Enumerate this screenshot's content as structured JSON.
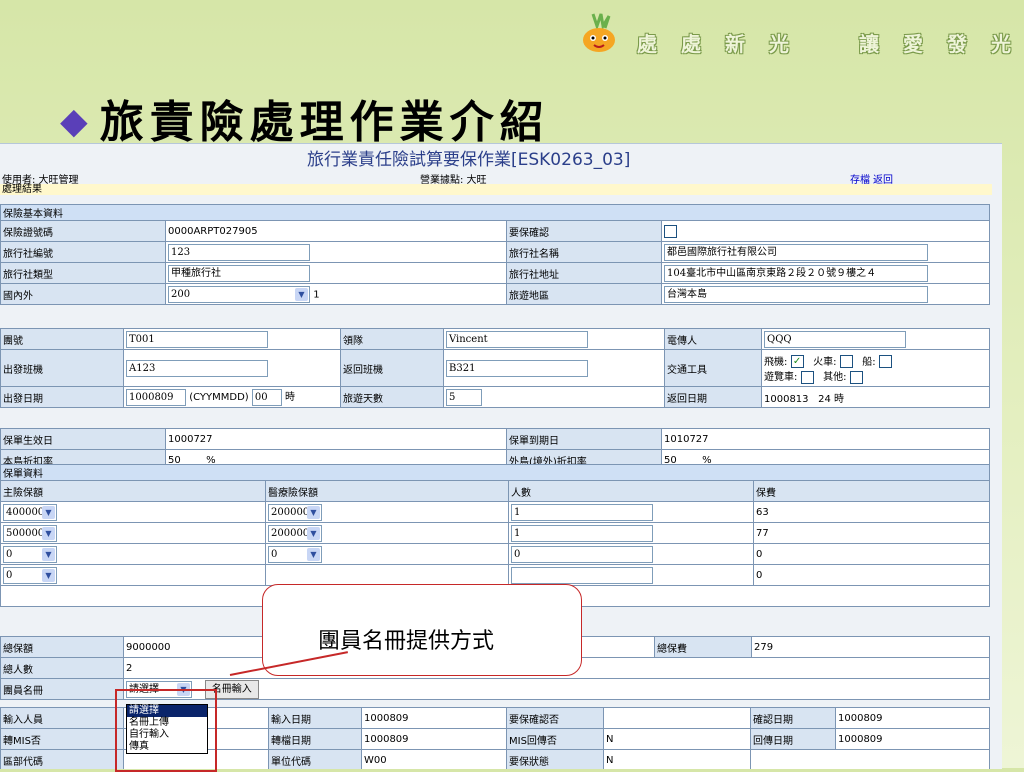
{
  "slogan": [
    "處",
    "處",
    "新",
    "光",
    "讓",
    "愛",
    "發",
    "光"
  ],
  "page_title": "旅責險處理作業介紹",
  "form_title": "旅行業責任險試算要保作業[ESK0263_03]",
  "user": "使用者: 大旺管理",
  "branch": "營業據點: 大旺",
  "links": {
    "save": "存檔",
    "back": "返回"
  },
  "result_label": "處理結果",
  "basic": {
    "section": "保險基本資料",
    "policy_no_label": "保險證號碼",
    "policy_no": "0000ARPT027905",
    "confirm_label": "要保確認",
    "agency_no_label": "旅行社編號",
    "agency_no": "123",
    "agency_name_label": "旅行社名稱",
    "agency_name": "都邑國際旅行社有限公司",
    "agency_type_label": "旅行社類型",
    "agency_type": "甲種旅行社",
    "agency_addr_label": "旅行社地址",
    "agency_addr": "104臺北市中山區南京東路２段２０號９樓之４",
    "domestic_label": "國內外",
    "domestic": "200",
    "domestic_code": "1",
    "region_label": "旅遊地區",
    "region": "台灣本島"
  },
  "trip": {
    "group_label": "團號",
    "group": "T001",
    "leader_label": "領隊",
    "leader": "Vincent",
    "contact_label": "電傳人",
    "contact": "QQQ",
    "depart_flight_label": "出發班機",
    "depart_flight": "A123",
    "return_flight_label": "返回班機",
    "return_flight": "B321",
    "transport_label": "交通工具",
    "plane": "飛機:",
    "train": "火車:",
    "ship": "船:",
    "bus": "遊覽車:",
    "other": "其他:",
    "depart_date_label": "出發日期",
    "depart_date": "1000809",
    "date_fmt": "(CYYMMDD)",
    "depart_hour": "00",
    "hour_unit": "時",
    "days_label": "旅遊天數",
    "days": "5",
    "return_date_label": "返回日期",
    "return_date": "1000813",
    "return_hour": "24",
    "return_hour_unit": "時",
    "effective_label": "保單生效日",
    "effective": "1000727",
    "expiry_label": "保單到期日",
    "expiry": "1010727",
    "island_rate_label": "本島折扣率",
    "island_rate": "50",
    "pct": "%",
    "outer_rate_label": "外島(境外)折扣率",
    "outer_rate": "50"
  },
  "policy": {
    "section": "保單資料",
    "headers": [
      "主險保額",
      "醫療險保額",
      "人數",
      "保費"
    ],
    "rows": [
      {
        "main": "4000000",
        "medical": "200000",
        "people": "1",
        "premium": "63"
      },
      {
        "main": "5000000",
        "medical": "200000",
        "people": "1",
        "premium": "77"
      },
      {
        "main": "0",
        "medical": "0",
        "people": "0",
        "premium": "0"
      },
      {
        "main": "0",
        "medical": "",
        "people": "",
        "premium": "0"
      }
    ],
    "total_amount_label": "總保額",
    "total_amount": "9000000",
    "total_premium_label": "總保費",
    "total_premium": "279",
    "total_people_label": "總人數",
    "total_people": "2",
    "roster_label": "團員名冊",
    "roster_select": "請選擇",
    "roster_button": "名冊輸入",
    "entry_label": "輸入人員",
    "entry_date_label": "輸入日期",
    "entry_date": "1000809",
    "confirm_q_label": "要保確認否",
    "confirm_date_label": "確認日期",
    "confirm_date": "1000809",
    "mis_label": "轉MIS否",
    "transfer_date_label": "轉檔日期",
    "transfer_date": "1000809",
    "mis_return_label": "MIS回傳否",
    "mis_return": "N",
    "return_date_label": "回傳日期",
    "return_date": "1000809",
    "dept_label": "區部代碼",
    "unit_label": "單位代碼",
    "unit": "W00",
    "status_label": "要保狀態",
    "status": "N"
  },
  "callout": "團員名冊提供方式",
  "dropdown_options": [
    "請選擇",
    "名冊上傳",
    "自行輸入",
    "傳真"
  ]
}
